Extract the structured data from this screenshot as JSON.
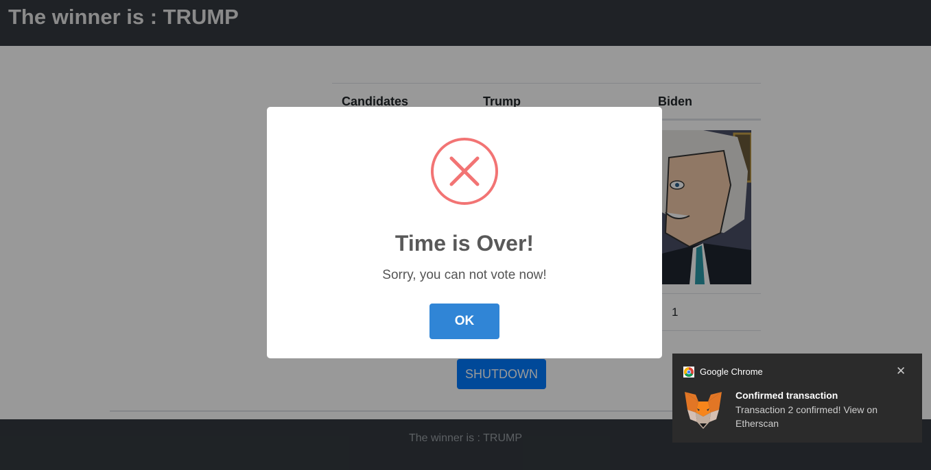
{
  "header": {
    "title": "The winner is : TRUMP"
  },
  "table": {
    "headers": [
      "Candidates",
      "Trump",
      "Biden"
    ],
    "votes_label": "",
    "trump_votes": "",
    "biden_votes": "1"
  },
  "actions": {
    "shutdown_label": "SHUTDOWN"
  },
  "footer": {
    "text": "The winner is : TRUMP"
  },
  "modal": {
    "icon": "error-x-icon",
    "title": "Time is Over!",
    "text": "Sorry, you can not vote now!",
    "ok_label": "OK",
    "icon_color": "#f27474",
    "button_color": "#3085d6"
  },
  "notification": {
    "app_name": "Google Chrome",
    "title": "Confirmed transaction",
    "body": "Transaction 2 confirmed! View on Etherscan",
    "close_icon": "close-icon",
    "app_icon": "chrome-icon",
    "image_icon": "metamask-fox-icon"
  },
  "colors": {
    "navbar": "#343a40",
    "primary": "#007bff"
  }
}
